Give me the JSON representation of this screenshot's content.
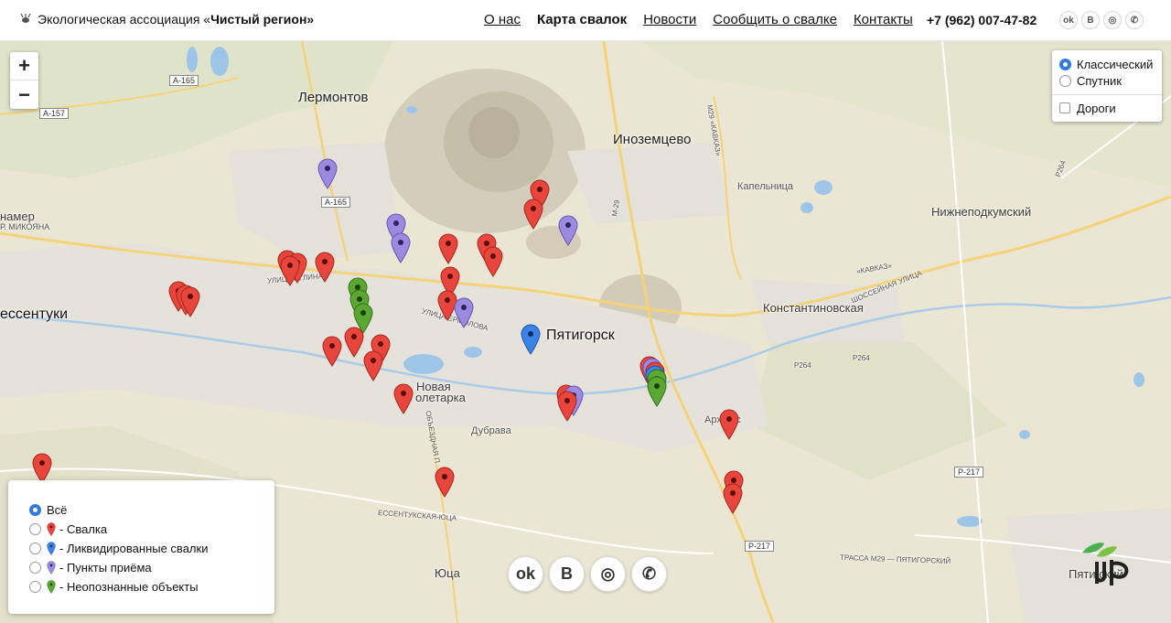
{
  "header": {
    "brand_prefix": "Экологическая ассоциация «",
    "brand_name": "Чистый регион",
    "brand_suffix": "»",
    "nav": [
      {
        "label": "О нас",
        "active": false
      },
      {
        "label": "Карта свалок",
        "active": true
      },
      {
        "label": "Новости",
        "active": false
      },
      {
        "label": "Сообщить о свалке",
        "active": false
      },
      {
        "label": "Контакты",
        "active": false
      }
    ],
    "phone": "+7 (962) 007-47-82",
    "socials": [
      {
        "icon": "odnoklassniki-icon",
        "glyph": "ok"
      },
      {
        "icon": "vk-icon",
        "glyph": "B"
      },
      {
        "icon": "instagram-icon",
        "glyph": "◎"
      },
      {
        "icon": "whatsapp-icon",
        "glyph": "✆"
      }
    ]
  },
  "map": {
    "zoom_in": "+",
    "zoom_out": "−",
    "layers": {
      "classic": "Классический",
      "satellite": "Спутник",
      "roads": "Дороги"
    },
    "labels": {
      "lermontov": "Лермонтов",
      "inozemtsevo": "Иноземцево",
      "kapelnitsa": "Капельница",
      "nizhnepodkumsky": "Нижнеподкумский",
      "konstantinovskaya": "Константиновская",
      "pyatigorsk": "Пятигорск",
      "essentuki": "ессентуки",
      "namer": "намер",
      "mikoyana": "Р. МИКОЯНА",
      "novaya_proletarka_1": "Новая",
      "novaya_proletarka_2": "олетарка",
      "dubrava": "Дубрава",
      "arkhyz_les": "Арх        лес",
      "yutsa": "Юца",
      "pyatigorsky": "Пяти   ский",
      "essentukskaya": "ЕССЕНТУКСКАЯ-ЮЦА",
      "trassa": "ТРАССА М29 — ПЯТИГОРСКИЙ",
      "street_iglina": "УЛИЦА ИГЛИНА",
      "street_ermolova": "УЛИЦА ЕРМОЛОВА",
      "street_shosseynaya": "ШОССЕЙНАЯ УЛИЦА",
      "kavkaz": "«КАВКАЗ»",
      "obezdnaya": "ОБЪЕЗДНАЯ П",
      "road_a165_1": "А-165",
      "road_a165_2": "А-165",
      "road_a157": "А-157",
      "road_p217_1": "Р-217",
      "road_p217_2": "Р-217",
      "road_p264_1": "Р264",
      "road_p264_2": "Р264",
      "road_p264_3": "Р264",
      "road_m29": "М29 «КАВКАЗ»",
      "road_m29_short": "М-29"
    }
  },
  "legend": {
    "items": [
      {
        "label": "Всё",
        "selected": true,
        "pin": null
      },
      {
        "label": "- Свалка",
        "selected": false,
        "pin": "red"
      },
      {
        "label": "- Ликвидированные свалки",
        "selected": false,
        "pin": "blue"
      },
      {
        "label": "- Пункты приёма",
        "selected": false,
        "pin": "purple"
      },
      {
        "label": "- Неопознанные объекты",
        "selected": false,
        "pin": "green"
      }
    ]
  },
  "colors": {
    "red": "#e8453c",
    "blue": "#3b82e8",
    "purple": "#9a8be0",
    "green": "#5aa832",
    "accent": "#2f7be0"
  },
  "pins": [
    {
      "color": "purple"
    },
    {
      "color": "red"
    },
    {
      "color": "red"
    },
    {
      "color": "purple"
    },
    {
      "color": "purple"
    },
    {
      "color": "purple"
    },
    {
      "color": "red"
    },
    {
      "color": "red"
    },
    {
      "color": "red"
    },
    {
      "color": "red"
    },
    {
      "color": "red"
    },
    {
      "color": "red"
    },
    {
      "color": "red"
    },
    {
      "color": "red"
    },
    {
      "color": "red"
    },
    {
      "color": "red"
    },
    {
      "color": "red"
    },
    {
      "color": "red"
    },
    {
      "color": "red"
    },
    {
      "color": "green"
    },
    {
      "color": "green"
    },
    {
      "color": "green"
    },
    {
      "color": "purple"
    },
    {
      "color": "red"
    },
    {
      "color": "red"
    },
    {
      "color": "red"
    },
    {
      "color": "red"
    },
    {
      "color": "red"
    },
    {
      "color": "blue"
    },
    {
      "color": "purple"
    },
    {
      "color": "red"
    },
    {
      "color": "red"
    },
    {
      "color": "purple"
    },
    {
      "color": "red"
    },
    {
      "color": "blue"
    },
    {
      "color": "green"
    },
    {
      "color": "green"
    },
    {
      "color": "red"
    },
    {
      "color": "red"
    },
    {
      "color": "red"
    },
    {
      "color": "red"
    },
    {
      "color": "red"
    }
  ],
  "bottom_socials": [
    {
      "icon": "odnoklassniki-icon",
      "glyph": "ok"
    },
    {
      "icon": "vk-icon",
      "glyph": "B"
    },
    {
      "icon": "instagram-icon",
      "glyph": "◎"
    },
    {
      "icon": "whatsapp-icon",
      "glyph": "✆"
    }
  ]
}
